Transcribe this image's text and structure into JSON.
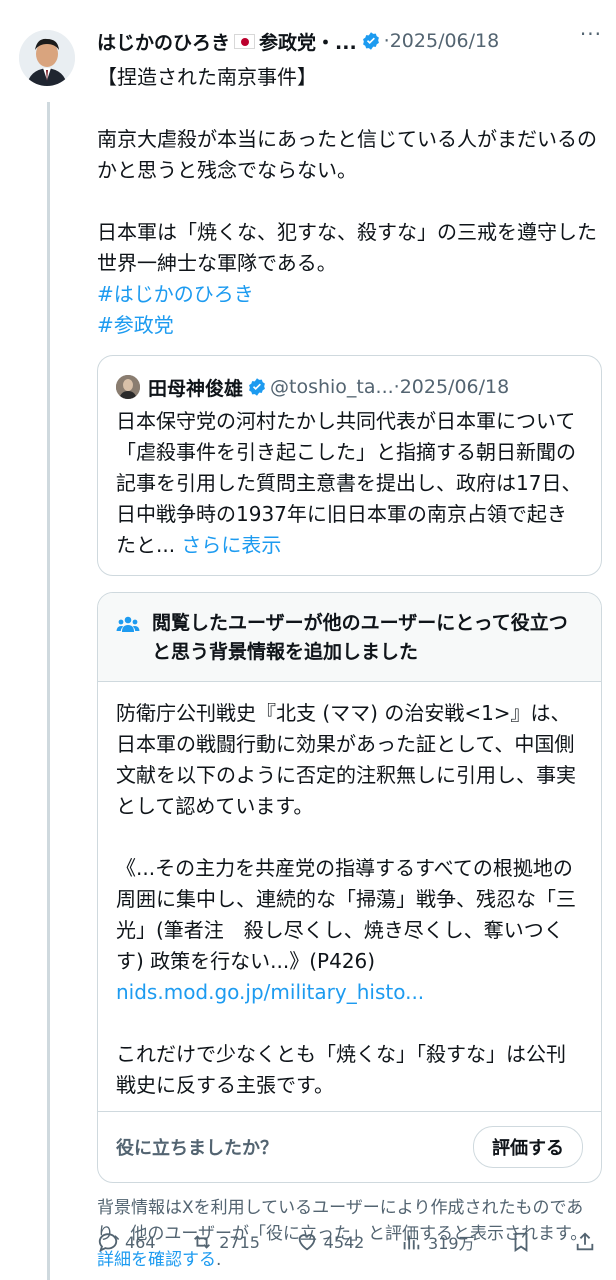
{
  "post": {
    "author_name": "はじかのひろき",
    "author_name_suffix": "参政党・...",
    "separator": "·",
    "date": "2025/06/18",
    "more": "···",
    "headline": "【捏造された南京事件】",
    "paragraph1": "南京大虐殺が本当にあったと信じている人がまだいるのかと思うと残念でならない。",
    "paragraph2": "日本軍は「焼くな、犯すな、殺すな」の三戒を遵守した世界一紳士な軍隊である。",
    "hashtags": [
      "#はじかのひろき",
      "#参政党"
    ]
  },
  "quote": {
    "author_name": "田母神俊雄",
    "handle": "@toshio_ta...",
    "separator": "·",
    "date": "2025/06/18",
    "text": "日本保守党の河村たかし共同代表が日本軍について「虐殺事件を引き起こした」と指摘する朝日新聞の記事を引用した質問主意書を提出し、政府は17日、日中戦争時の1937年に旧日本軍の南京占領で起きたと...",
    "show_more": " さらに表示"
  },
  "community_note": {
    "title": "閲覧したユーザーが他のユーザーにとって役立つと思う背景情報を追加しました",
    "para1": "防衛庁公刊戦史『北支 (ママ) の治安戦<1>』は、日本軍の戦闘行動に効果があった証として、中国側文献を以下のように否定的注釈無しに引用し、事実として認めています。",
    "para2": "《...その主力を共産党の指導するすべての根拠地の周囲に集中し、連続的な「掃蕩」戦争、残忍な「三光」(筆者注　殺し尽くし、焼き尽くし、奪いつくす) 政策を行ない...》(P426)",
    "link": "nids.mod.go.jp/military_histo...",
    "para3": "これだけで少なくとも「焼くな」「殺すな」は公刊戦史に反する主張です。",
    "helpful_question": "役に立ちましたか？",
    "rate_button": "評価する"
  },
  "disclaimer": {
    "text": "背景情報はXを利用しているユーザーにより作成されたものであり、他のユーザーが「役に立った」と評価すると表示されます。",
    "link": "詳細を確認する",
    "end": "."
  },
  "actions": {
    "replies": "464",
    "reposts": "2715",
    "likes": "4542",
    "views": "319万"
  },
  "colors": {
    "accent": "#1d9bf0",
    "text": "#0f1419",
    "secondary": "#536471",
    "border": "#cfd9de"
  }
}
